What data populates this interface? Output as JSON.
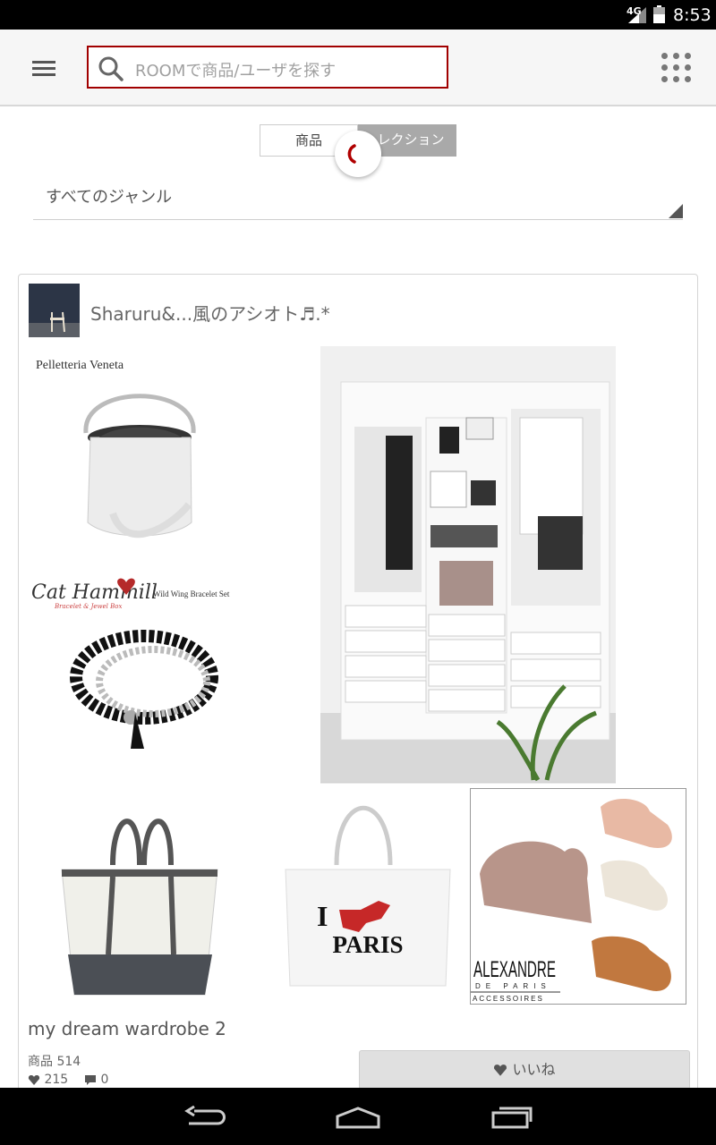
{
  "status_bar": {
    "network": "4G",
    "time": "8:53"
  },
  "header": {
    "menu_icon": "hamburger-menu-icon",
    "search_placeholder": "ROOMで商品/ユーザを探す",
    "search_icon": "search-icon",
    "apps_icon": "grid-apps-icon",
    "search_border_color": "#a10000"
  },
  "tabs": [
    {
      "label": "商品",
      "selected": false
    },
    {
      "label": "レクション",
      "selected": true
    }
  ],
  "genre_dropdown": {
    "selected": "すべてのジャンル"
  },
  "collection_card": {
    "owner_name": "Sharuru&...風のアシオト♬.*",
    "images": [
      {
        "brand_text": "Pelletteria Veneta",
        "depicts": "white bucket bag"
      },
      {
        "brand_text": "Cat Hammill",
        "sub_text": "Wild Wing Bracelet Set",
        "script_text": "Bracelet & Jewel Box",
        "depicts": "black beaded bracelet"
      },
      {
        "depicts": "white closet wardrobe"
      },
      {
        "depicts": "canvas tote bag"
      },
      {
        "depicts": "I fox PARIS tote bag",
        "text_i": "I",
        "text_paris": "PARIS"
      },
      {
        "brand_text": "ALEXANDRE",
        "sub_text": "DE PARIS",
        "sub_text2": "ACCESSOIRES",
        "depicts": "hair claw clips"
      }
    ],
    "title": "my dream wardrobe 2",
    "items_label": "商品",
    "items_count": "514",
    "likes": "215",
    "comments": "0",
    "like_button_label": "いいね",
    "heart_icon": "heart-icon",
    "comment_icon": "comment-icon"
  },
  "nav_bar": {
    "back": "back-icon",
    "home": "home-icon",
    "recents": "recent-apps-icon"
  }
}
